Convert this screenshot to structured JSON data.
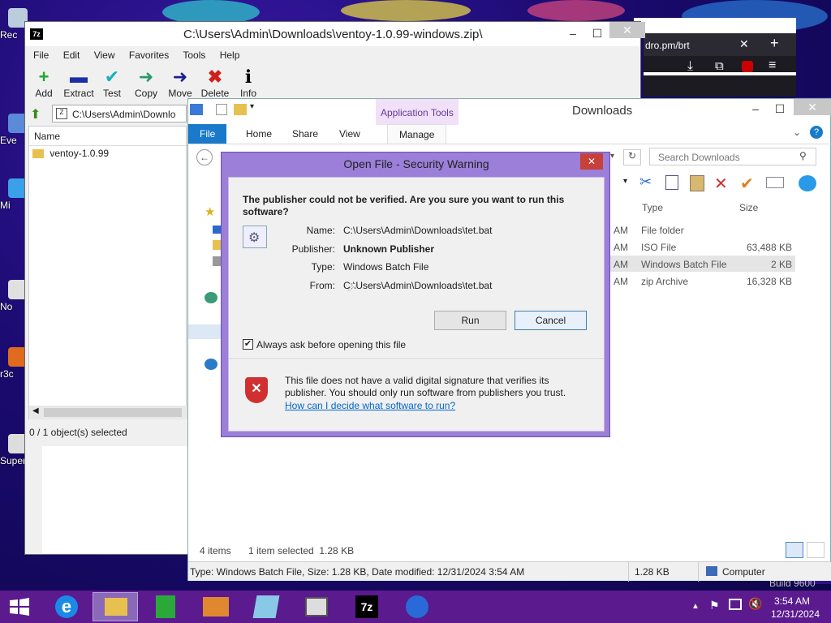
{
  "desktop": {
    "icons": [
      {
        "label": "Rec"
      },
      {
        "label": "Eve"
      },
      {
        "label": "Mi"
      },
      {
        "label": "No"
      },
      {
        "label": "r3c"
      },
      {
        "label": "Superm"
      }
    ],
    "build_text": "Build 9600"
  },
  "browser": {
    "tab_url": "dro.pm/brt"
  },
  "sevenzip": {
    "title": "C:\\Users\\Admin\\Downloads\\ventoy-1.0.99-windows.zip\\",
    "menu": [
      "File",
      "Edit",
      "View",
      "Favorites",
      "Tools",
      "Help"
    ],
    "toolbar": [
      "Add",
      "Extract",
      "Test",
      "Copy",
      "Move",
      "Delete",
      "Info"
    ],
    "path": "C:\\Users\\Admin\\Downlo",
    "column_name": "Name",
    "items": [
      "ventoy-1.0.99"
    ],
    "status": "0 / 1 object(s) selected"
  },
  "explorer": {
    "title": "Downloads",
    "context_tab": "Application Tools",
    "tabs": [
      "File",
      "Home",
      "Share",
      "View",
      "Manage"
    ],
    "search_placeholder": "Search Downloads",
    "columns": {
      "type": "Type",
      "size": "Size"
    },
    "rows": [
      {
        "time": "AM",
        "type": "File folder",
        "size": ""
      },
      {
        "time": "AM",
        "type": "ISO File",
        "size": "63,488 KB"
      },
      {
        "time": "AM",
        "type": "Windows Batch File",
        "size": "2 KB"
      },
      {
        "time": "AM",
        "type": "zip Archive",
        "size": "16,328 KB"
      }
    ],
    "status_items": "4 items",
    "status_selected": "1 item selected  1.28 KB",
    "details": "Type: Windows Batch File, Size: 1.28 KB, Date modified: 12/31/2024 3:54 AM",
    "details_size": "1.28 KB",
    "details_location": "Computer"
  },
  "dialog": {
    "title": "Open File - Security Warning",
    "question": "The publisher could not be verified.  Are you sure you want to run this software?",
    "fields": [
      {
        "label": "Name:",
        "value": "C:\\Users\\Admin\\Downloads\\tet.bat"
      },
      {
        "label": "Publisher:",
        "value": "Unknown Publisher"
      },
      {
        "label": "Type:",
        "value": "Windows Batch File"
      },
      {
        "label": "From:",
        "value": "C:\\Users\\Admin\\Downloads\\tet.bat"
      }
    ],
    "run": "Run",
    "cancel": "Cancel",
    "checkbox_label": "Always ask before opening this file",
    "checkbox_checked": true,
    "warning": "This file does not have a valid digital signature that verifies its publisher.  You should only run software from publishers you trust.",
    "link": "How can I decide what software to run?"
  },
  "taskbar": {
    "time": "3:54 AM",
    "date": "12/31/2024"
  }
}
